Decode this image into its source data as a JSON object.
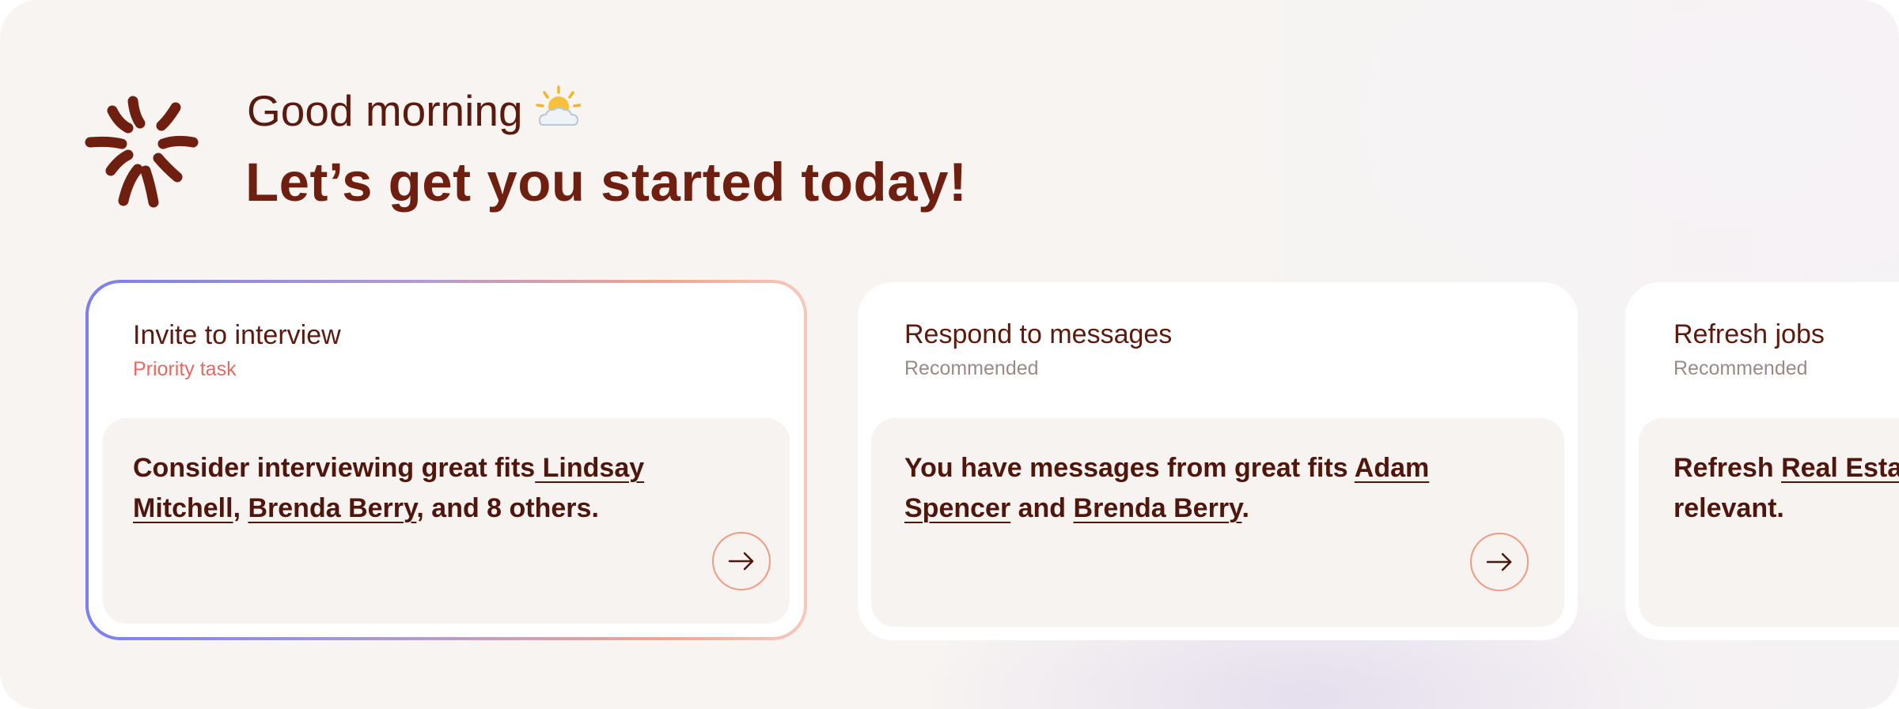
{
  "header": {
    "greeting": "Good morning",
    "headline": "Let’s get you started today!",
    "weather_icon": "sun-behind-cloud-icon",
    "logo_icon": "sunburst-logo-icon"
  },
  "cards": [
    {
      "title": "Invite to interview",
      "tag": "Priority task",
      "line1_prefix": "Consider interviewing great fits",
      "line1_link": " Lindsay",
      "line2_link_a": "Mitchell",
      "line2_sep": ", ",
      "line2_link_b": "Brenda Berry",
      "line2_suffix": ", and 8 others.",
      "action_icon": "arrow-right-icon"
    },
    {
      "title": "Respond to messages",
      "tag": "Recommended",
      "line1_prefix": "You have messages from great fits ",
      "line1_link": "Adam",
      "line2_link_a": "Spencer",
      "line2_sep": " and ",
      "line2_link_b": "Brenda Berry",
      "line2_suffix": ".",
      "action_icon": "arrow-right-icon"
    },
    {
      "title": "Refresh jobs",
      "tag": "Recommended",
      "line1_prefix": "Refresh ",
      "line1_link": "Real Estat",
      "line2_text": "relevant."
    }
  ],
  "colors": {
    "brand": "#6e1f10",
    "priority": "#e36b62",
    "recommended": "#9b8b86",
    "button_border": "#ee9b84"
  }
}
